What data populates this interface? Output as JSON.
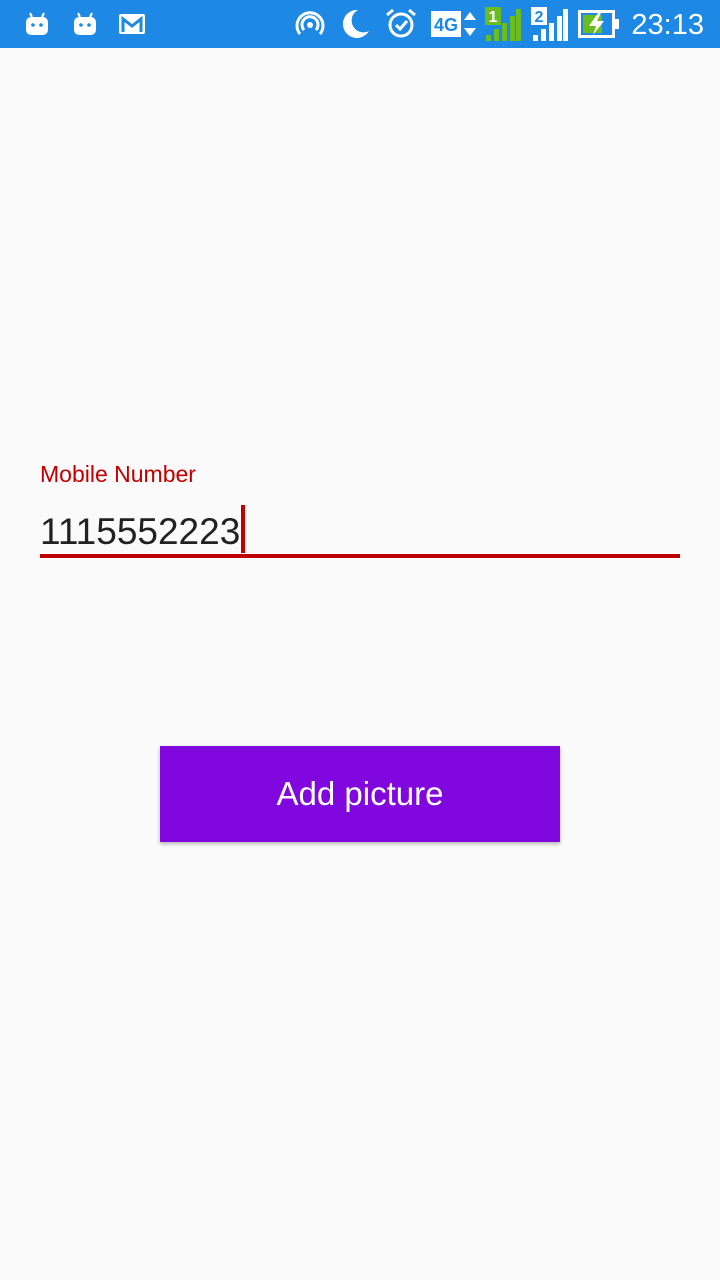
{
  "status_bar": {
    "time": "23:13",
    "network_type": "4G",
    "sim1_label": "1",
    "sim2_label": "2",
    "icons": [
      "android-icon",
      "android-icon",
      "gmail-icon",
      "hotspot-icon",
      "moon-icon",
      "alarm-icon",
      "network-4g-icon",
      "signal-sim1-icon",
      "signal-sim2-icon",
      "battery-charging-icon"
    ],
    "background_color": "#1e88e5"
  },
  "form": {
    "mobile_label": "Mobile Number",
    "mobile_value": "1115552223",
    "accent_color": "#c00000"
  },
  "actions": {
    "add_picture_label": "Add picture",
    "button_color": "#8008de"
  }
}
